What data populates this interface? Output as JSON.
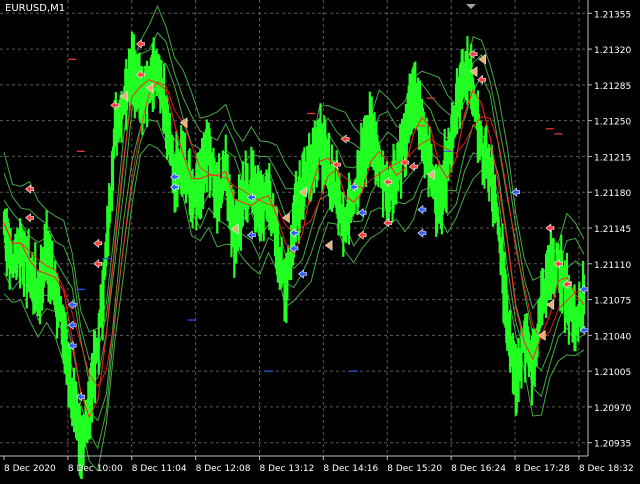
{
  "window": {
    "symbol_title": "EURUSD,M1"
  },
  "chart_data": {
    "type": "line",
    "title": "",
    "xlabel": "",
    "ylabel": "",
    "background": "#000000",
    "grid": true,
    "grid_color": "#5a5a5a",
    "axis_color": "#bdbdbd",
    "text_color": "#ffffff",
    "y_ticks": [
      "1.21355",
      "1.21320",
      "1.21285",
      "1.21250",
      "1.21215",
      "1.21180",
      "1.21145",
      "1.21110",
      "1.21075",
      "1.21040",
      "1.21005",
      "1.20970",
      "1.20935"
    ],
    "ylim": [
      1.20922,
      1.21368
    ],
    "x_ticks": [
      "8 Dec 2020",
      "8 Dec 10:00",
      "8 Dec 11:04",
      "8 Dec 12:08",
      "8 Dec 13:12",
      "8 Dec 14:16",
      "8 Dec 15:20",
      "8 Dec 16:24",
      "8 Dec 17:28",
      "8 Dec 18:32"
    ],
    "series": [
      {
        "color": "#22ff22",
        "style": "bars",
        "values": [
          1.2115,
          1.2111,
          1.2113,
          1.211,
          1.2108,
          1.2112,
          1.2109,
          1.2104,
          1.2098,
          1.2093,
          1.2097,
          1.2103,
          1.2112,
          1.2124,
          1.2127,
          1.2131,
          1.2127,
          1.2129,
          1.213,
          1.2125,
          1.2119,
          1.2121,
          1.2118,
          1.2119,
          1.2122,
          1.2118,
          1.212,
          1.2114,
          1.2117,
          1.2119,
          1.2116,
          1.2118,
          1.2113,
          1.2108,
          1.2115,
          1.2119,
          1.2121,
          1.2123,
          1.212,
          1.2118,
          1.2115,
          1.2118,
          1.2121,
          1.2124,
          1.2121,
          1.2118,
          1.212,
          1.2123,
          1.2128,
          1.2125,
          1.212,
          1.2117,
          1.2121,
          1.2126,
          1.213,
          1.2128,
          1.2122,
          1.212,
          1.2114,
          1.2106,
          1.21,
          1.2104,
          1.2101,
          1.2107,
          1.211,
          1.2111,
          1.2108,
          1.2105,
          1.2108
        ]
      },
      {
        "color": "#ff2222",
        "style": "line"
      },
      {
        "color": "#4cbb4c",
        "style": "envelope"
      }
    ],
    "signal_markers": {
      "buy_color": "#2f5bff",
      "sell_color": "#ff3b3b",
      "exit_color": "#e8b07a",
      "sell": [
        [
          3,
          1.21183
        ],
        [
          3,
          1.21155
        ],
        [
          11,
          1.2113
        ],
        [
          11,
          1.2111
        ],
        [
          16,
          1.21325
        ],
        [
          16,
          1.21295
        ],
        [
          13,
          1.21265
        ],
        [
          39,
          1.21207
        ],
        [
          40,
          1.21232
        ],
        [
          45,
          1.2119
        ],
        [
          47,
          1.21209
        ],
        [
          48,
          1.21205
        ],
        [
          55,
          1.21315
        ],
        [
          56,
          1.2129
        ],
        [
          64,
          1.21145
        ],
        [
          65,
          1.2111
        ],
        [
          66,
          1.2109
        ],
        [
          45,
          1.2115
        ],
        [
          42,
          1.21138
        ]
      ],
      "buy": [
        [
          8,
          1.2107
        ],
        [
          8,
          1.2105
        ],
        [
          8,
          1.2103
        ],
        [
          9,
          1.2098
        ],
        [
          20,
          1.21195
        ],
        [
          20,
          1.21185
        ],
        [
          29,
          1.21175
        ],
        [
          29,
          1.21138
        ],
        [
          34,
          1.2114
        ],
        [
          34,
          1.21125
        ],
        [
          35,
          1.211
        ],
        [
          41,
          1.21185
        ],
        [
          42,
          1.2116
        ],
        [
          49,
          1.21163
        ],
        [
          49,
          1.2114
        ],
        [
          60,
          1.2118
        ],
        [
          68,
          1.21085
        ],
        [
          68,
          1.21045
        ]
      ],
      "exit": [
        [
          17,
          1.21282
        ],
        [
          14,
          1.21274
        ],
        [
          21,
          1.21248
        ],
        [
          27,
          1.21144
        ],
        [
          33,
          1.21155
        ],
        [
          35,
          1.2118
        ],
        [
          38,
          1.21128
        ],
        [
          50,
          1.21197
        ],
        [
          55,
          1.21298
        ],
        [
          56,
          1.2131
        ],
        [
          63,
          1.2104
        ],
        [
          64,
          1.2107
        ]
      ],
      "dash_red": [
        [
          8,
          1.2131
        ],
        [
          9,
          1.2122
        ],
        [
          36,
          1.21257
        ],
        [
          64,
          1.21242
        ],
        [
          65,
          1.21237
        ],
        [
          49,
          1.21245
        ],
        [
          50,
          1.21272
        ]
      ],
      "dash_blue": [
        [
          9,
          1.21085
        ],
        [
          31,
          1.21005
        ],
        [
          22,
          1.21055
        ],
        [
          41,
          1.21005
        ],
        [
          12,
          1.21115
        ],
        [
          52,
          1.2122
        ]
      ]
    }
  }
}
